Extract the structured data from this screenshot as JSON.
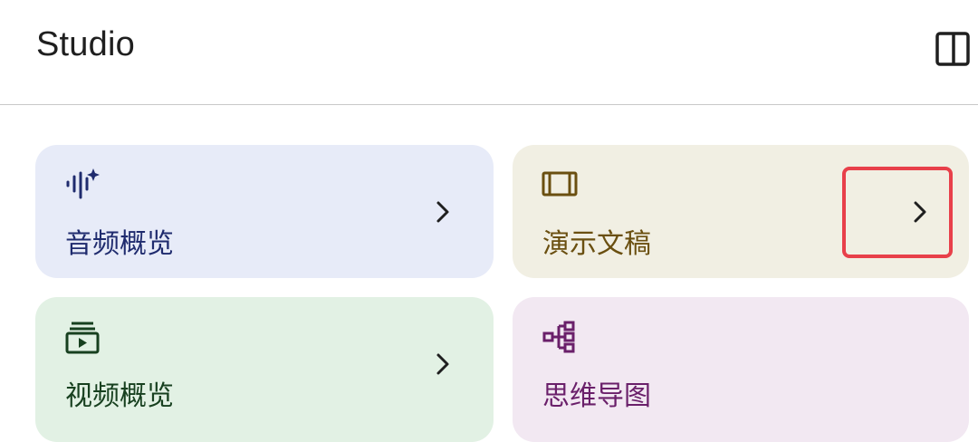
{
  "header": {
    "title": "Studio",
    "panel_toggle_icon": "side-panel-icon"
  },
  "cards": [
    {
      "label": "音频概览",
      "icon": "audio-sparkle-icon",
      "color": "#1f2b6e",
      "background": "#e7ebf8"
    },
    {
      "label": "演示文稿",
      "icon": "slides-icon",
      "color": "#6a4f10",
      "background": "#f1efe3"
    },
    {
      "label": "视频概览",
      "icon": "video-play-icon",
      "color": "#17401f",
      "background": "#e2f1e4"
    },
    {
      "label": "思维导图",
      "icon": "mind-map-icon",
      "color": "#6a1f6a",
      "background": "#f2e8f2"
    }
  ],
  "highlight": {
    "color": "#e8404a"
  }
}
